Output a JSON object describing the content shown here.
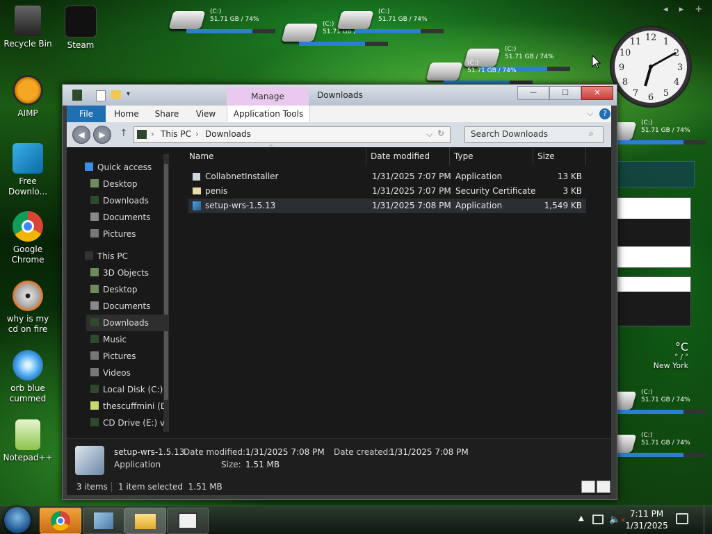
{
  "desktop": {
    "icons": [
      {
        "label": "Recycle Bin"
      },
      {
        "label": "Steam"
      },
      {
        "label": "AIMP"
      },
      {
        "label": "Free Downlo..."
      },
      {
        "label": "Google Chrome"
      },
      {
        "label": "why is my cd on fire"
      },
      {
        "label": "orb blue cummed"
      },
      {
        "label": "Notepad++"
      }
    ],
    "drive_gadget": {
      "name": "(C:)",
      "usage": "51.71 GB / 74%",
      "percent": 74
    },
    "weather": {
      "temp_unit": "°C",
      "range": "° / °",
      "city": "New York"
    },
    "gadget_nav": {
      "prev": "◂",
      "next": "▸",
      "add": "+"
    }
  },
  "explorer": {
    "quick_access_buttons": [
      "back",
      "forward"
    ],
    "ribbon_context_tab": "Manage",
    "window_title": "Downloads",
    "controls": {
      "minimize": "—",
      "maximize": "☐",
      "close": "✕"
    },
    "tabs": [
      "File",
      "Home",
      "Share",
      "View",
      "Application Tools"
    ],
    "address": {
      "crumbs": [
        "This PC",
        "Downloads"
      ],
      "sep": "›"
    },
    "search_placeholder": "Search Downloads",
    "nav": [
      {
        "label": "Quick access"
      },
      {
        "label": "Desktop"
      },
      {
        "label": "Downloads"
      },
      {
        "label": "Documents"
      },
      {
        "label": "Pictures"
      },
      {
        "label": "This PC"
      },
      {
        "label": "3D Objects"
      },
      {
        "label": "Desktop"
      },
      {
        "label": "Documents"
      },
      {
        "label": "Downloads"
      },
      {
        "label": "Music"
      },
      {
        "label": "Pictures"
      },
      {
        "label": "Videos"
      },
      {
        "label": "Local Disk (C:)"
      },
      {
        "label": "thescuffmini (D:)"
      },
      {
        "label": "CD Drive (E:) virt"
      }
    ],
    "columns": [
      "Name",
      "Date modified",
      "Type",
      "Size"
    ],
    "files": [
      {
        "name": "CollabnetInstaller",
        "date": "1/31/2025 7:07 PM",
        "type": "Application",
        "size": "13 KB"
      },
      {
        "name": "penis",
        "date": "1/31/2025 7:07 PM",
        "type": "Security Certificate",
        "size": "3 KB"
      },
      {
        "name": "setup-wrs-1.5.13",
        "date": "1/31/2025 7:08 PM",
        "type": "Application",
        "size": "1,549 KB"
      }
    ],
    "details": {
      "name": "setup-wrs-1.5.13",
      "kind": "Application",
      "date_modified_label": "Date modified:",
      "date_modified": "1/31/2025 7:08 PM",
      "date_created_label": "Date created:",
      "date_created": "1/31/2025 7:08 PM",
      "size_label": "Size:",
      "size": "1.51 MB"
    },
    "status": {
      "count": "3 items",
      "selection": "1 item selected  1.51 MB"
    }
  },
  "taskbar": {
    "time": "7:11 PM",
    "date": "1/31/2025"
  },
  "colors": {
    "accent": "#2a7fd0",
    "close": "#c9403a",
    "manage_tab": "#e9c9ee"
  }
}
